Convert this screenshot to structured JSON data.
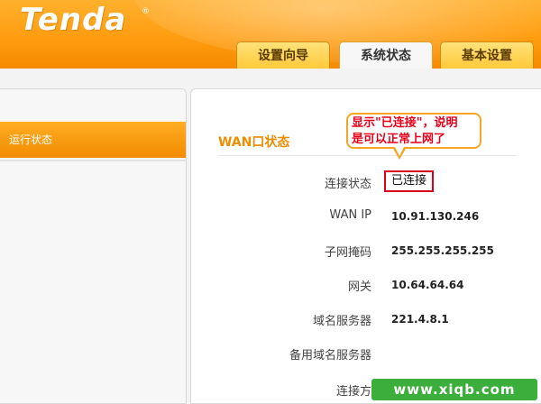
{
  "header": {
    "logo": "Tenda",
    "registered_mark": "®",
    "tabs": [
      {
        "label": "设置向导",
        "active": false
      },
      {
        "label": "系统状态",
        "active": true
      },
      {
        "label": "基本设置",
        "active": false
      }
    ]
  },
  "sidebar": {
    "items": [
      {
        "label": "运行状态",
        "selected": true
      }
    ]
  },
  "main": {
    "section_title": "WAN口状态",
    "connection_status": {
      "label": "连接状态",
      "value": "已连接"
    },
    "rows": [
      {
        "label": "WAN IP",
        "value": "10.91.130.246"
      },
      {
        "label": "子网掩码",
        "value": "255.255.255.255"
      },
      {
        "label": "网关",
        "value": "10.64.64.64"
      },
      {
        "label": "域名服务器",
        "value": "221.4.8.1"
      },
      {
        "label": "备用域名服务器",
        "value": ""
      },
      {
        "label": "连接方",
        "value": ""
      }
    ]
  },
  "annotation": {
    "line1": "显示\"已连接\"，说明",
    "line2": "是可以正常上网了"
  },
  "watermark": "www.xiqb.com",
  "colors": {
    "brand_orange": "#ff9d10",
    "title_orange": "#f08c00",
    "status_border": "#d9001b",
    "annotation_red": "#e8001a",
    "watermark_green": "#3cae3c"
  }
}
